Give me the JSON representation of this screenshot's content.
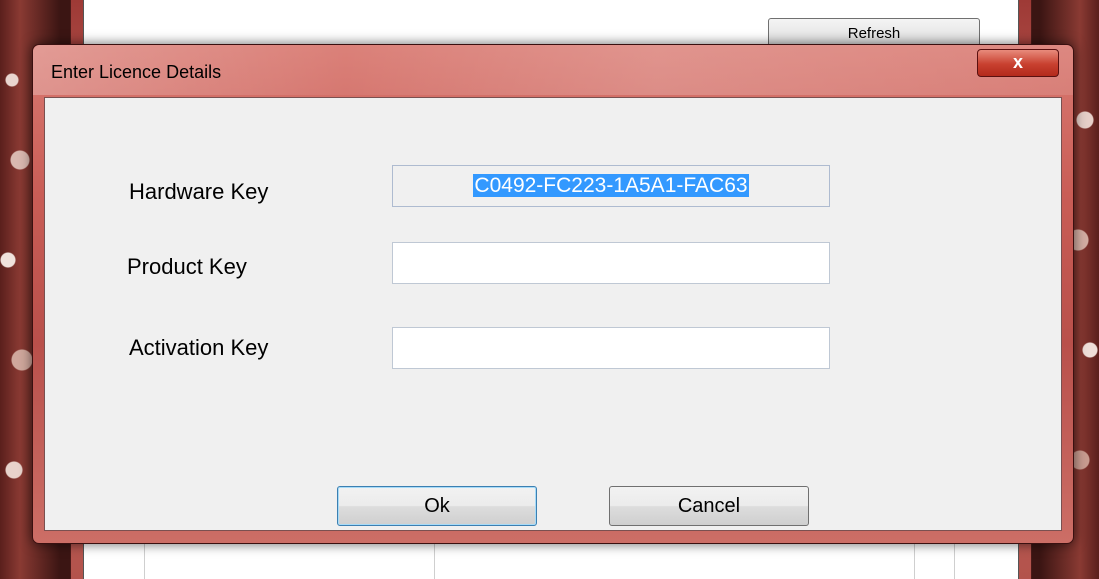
{
  "background_window": {
    "refresh_label": "Refresh"
  },
  "dialog": {
    "title": "Enter Licence Details",
    "close_glyph": "x",
    "fields": {
      "hardware_key_label": "Hardware Key",
      "hardware_key_value": "C0492-FC223-1A5A1-FAC63",
      "product_key_label": "Product Key",
      "product_key_value": "",
      "activation_key_label": "Activation Key",
      "activation_key_value": ""
    },
    "buttons": {
      "ok": "Ok",
      "cancel": "Cancel"
    }
  },
  "colors": {
    "selection": "#3399ff",
    "title_bar": "#c95d56",
    "close_button": "#c8402f"
  }
}
